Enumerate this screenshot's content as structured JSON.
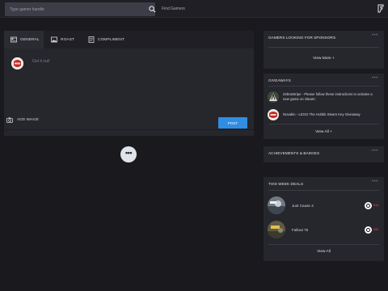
{
  "topbar": {
    "search_placeholder": "Type gamer handle",
    "find_gamers": "Find Gamers",
    "logo_icon": "gamer-logo-icon"
  },
  "composer": {
    "tabs": [
      {
        "label": "GENERAL",
        "icon": "newspaper-icon"
      },
      {
        "label": "ROAST",
        "icon": "image-icon"
      },
      {
        "label": "COMPLIMENT",
        "icon": "document-icon"
      }
    ],
    "placeholder": "Get it out!",
    "add_image": "ADD IMAGE",
    "post_button": "POST"
  },
  "feed": {
    "load_more": "•••"
  },
  "widgets": {
    "sponsors": {
      "title": "GAMERS LOOKING FOR SPONSORS",
      "menu": "•••",
      "link": "View More +"
    },
    "giveaways": {
      "title": "GIVEAWAYS",
      "menu": "•••",
      "items": [
        {
          "text": "ZebraStripe - Please follow these instructions to activate a new game on Steam:"
        },
        {
          "text": "Novakin - LEGO The Hobbit Steam Key Giveaway"
        }
      ],
      "link": "View All +"
    },
    "achievements": {
      "title": "ACHIEVEMENTS & BADGES",
      "menu": "•••"
    },
    "deals": {
      "title": "THIS WEEK DEALS",
      "menu": "•••",
      "items": [
        {
          "name": "Just Cause 4",
          "price": "$16"
        },
        {
          "name": "Fallout 76",
          "price": "$30"
        }
      ],
      "link": "View All"
    }
  },
  "colors": {
    "background": "#19191e",
    "card": "#26262d",
    "accent": "#2f8de4",
    "price": "#e94545"
  }
}
